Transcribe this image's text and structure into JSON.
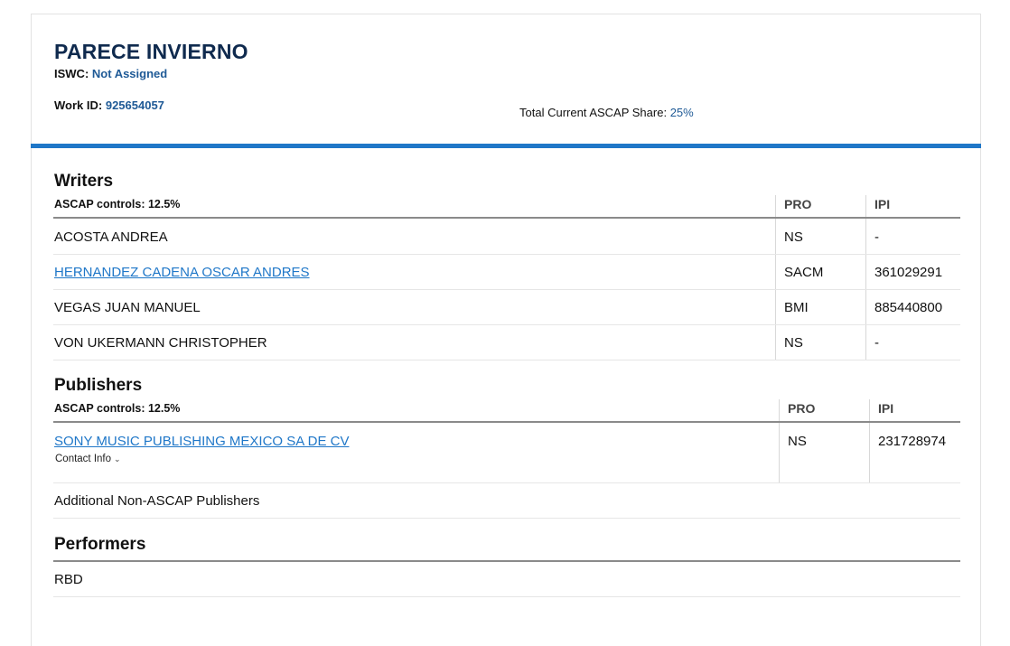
{
  "work": {
    "title": "PARECE INVIERNO",
    "iswc_label": "ISWC:",
    "iswc_value": "Not Assigned",
    "work_id_label": "Work ID:",
    "work_id_value": "925654057",
    "share_label": "Total Current ASCAP Share:",
    "share_value": "25%"
  },
  "writers": {
    "title": "Writers",
    "controls": "ASCAP controls: 12.5%",
    "col_pro": "PRO",
    "col_ipi": "IPI",
    "rows": [
      {
        "name": "ACOSTA ANDREA",
        "pro": "NS",
        "ipi": "-"
      },
      {
        "name": "HERNANDEZ CADENA OSCAR ANDRES",
        "pro": "SACM",
        "ipi": "361029291"
      },
      {
        "name": "VEGAS JUAN MANUEL",
        "pro": "BMI",
        "ipi": "885440800"
      },
      {
        "name": "VON UKERMANN CHRISTOPHER",
        "pro": "NS",
        "ipi": "-"
      }
    ]
  },
  "publishers": {
    "title": "Publishers",
    "controls": "ASCAP controls: 12.5%",
    "col_pro": "PRO",
    "col_ipi": "IPI",
    "rows": [
      {
        "name": "SONY MUSIC PUBLISHING MEXICO SA DE CV",
        "pro": "NS",
        "ipi": "231728974",
        "contact": "Contact Info"
      }
    ],
    "additional": "Additional Non-ASCAP Publishers"
  },
  "performers": {
    "title": "Performers",
    "items": [
      "RBD"
    ]
  },
  "colors": {
    "title_navy": "#0f2a4e",
    "accent_blue": "#1f77c8",
    "value_blue": "#1f5a96"
  }
}
